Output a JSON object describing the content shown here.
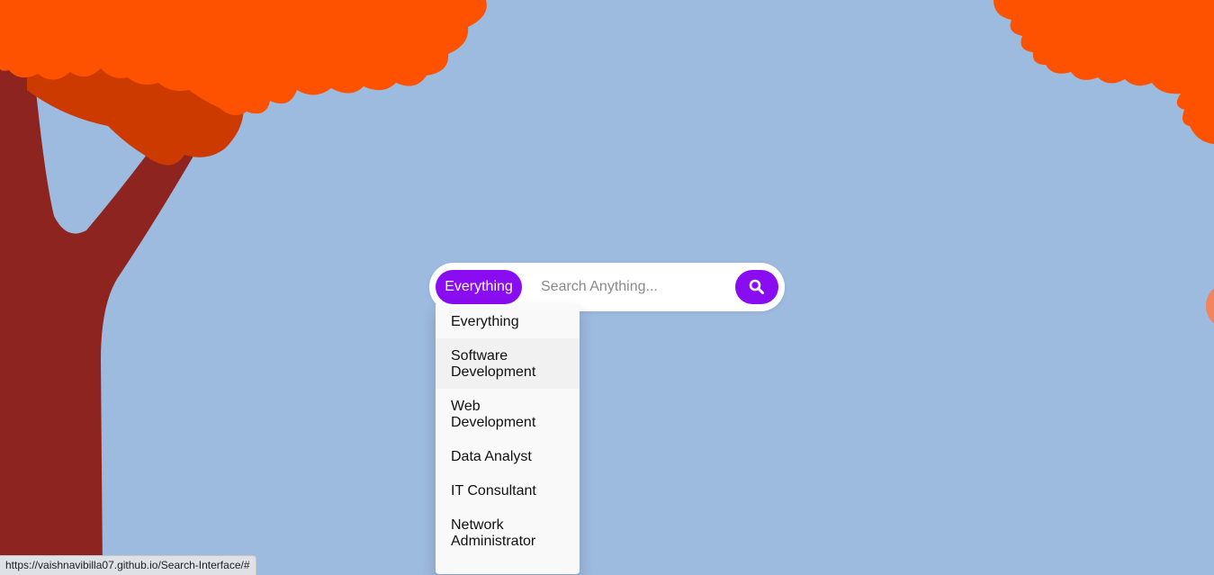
{
  "search": {
    "category_label": "Everything",
    "placeholder": "Search Anything...",
    "value": "",
    "button_icon": "search-icon"
  },
  "dropdown": {
    "items": [
      {
        "label": "Everything"
      },
      {
        "label": "Software Development"
      },
      {
        "label": "Web Development"
      },
      {
        "label": "Data Analyst"
      },
      {
        "label": "IT Consultant"
      },
      {
        "label": "Network Administrator"
      }
    ],
    "hovered_index": 1
  },
  "status_bar": {
    "url": "https://vaishnavibilla07.github.io/Search-Interface/#"
  },
  "colors": {
    "background": "#9dbadf",
    "accent": "#8a0cf1",
    "foliage": "#ff5200",
    "foliage_shadow": "#cc3a00",
    "trunk": "#8e2420"
  }
}
